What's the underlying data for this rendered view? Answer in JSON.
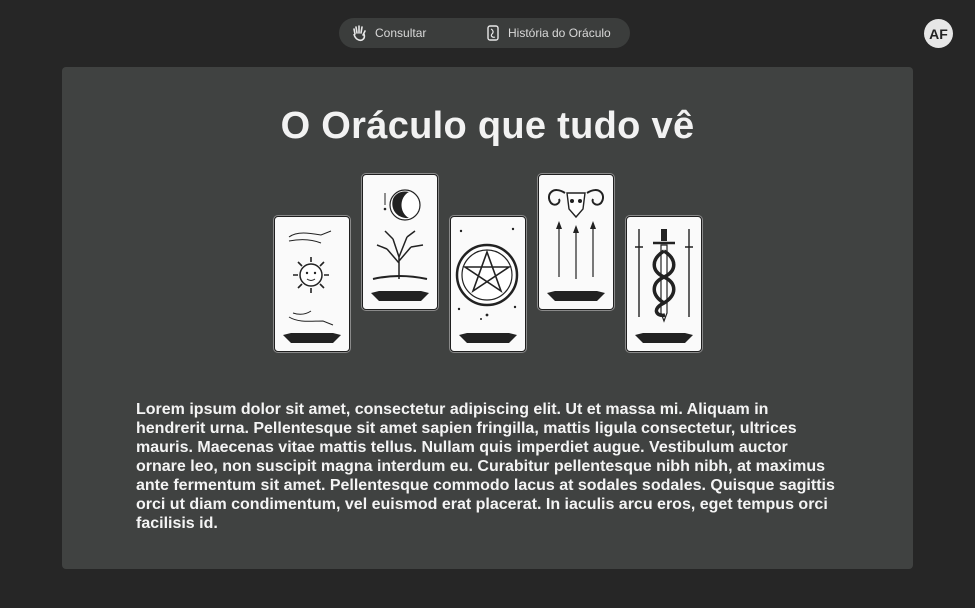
{
  "nav": {
    "consult_label": "Consultar",
    "consult_icon": "hand-icon",
    "history_label": "História do Oráculo",
    "history_icon": "scroll-icon"
  },
  "user": {
    "initials": "AF"
  },
  "main": {
    "title": "O Oráculo que tudo vê",
    "cards": [
      {
        "icon": "sun-card-icon"
      },
      {
        "icon": "moon-tree-card-icon"
      },
      {
        "icon": "pentacle-card-icon"
      },
      {
        "icon": "ram-skull-arrows-card-icon"
      },
      {
        "icon": "swords-serpent-card-icon"
      }
    ],
    "body": "Lorem ipsum dolor sit amet, consectetur adipiscing elit. Ut et massa mi. Aliquam in hendrerit urna. Pellentesque sit amet sapien fringilla, mattis ligula consectetur, ultrices mauris. Maecenas vitae mattis tellus. Nullam quis imperdiet augue. Vestibulum auctor ornare leo, non suscipit magna interdum eu. Curabitur pellentesque nibh nibh, at maximus ante fermentum sit amet. Pellentesque commodo lacus at sodales sodales. Quisque sagittis orci ut diam condimentum, vel euismod erat placerat. In iaculis arcu eros, eget tempus orci facilisis id."
  },
  "colors": {
    "background": "#262626",
    "panel": "#404241",
    "nav": "#3b3d3c",
    "card": "#fafafa"
  }
}
